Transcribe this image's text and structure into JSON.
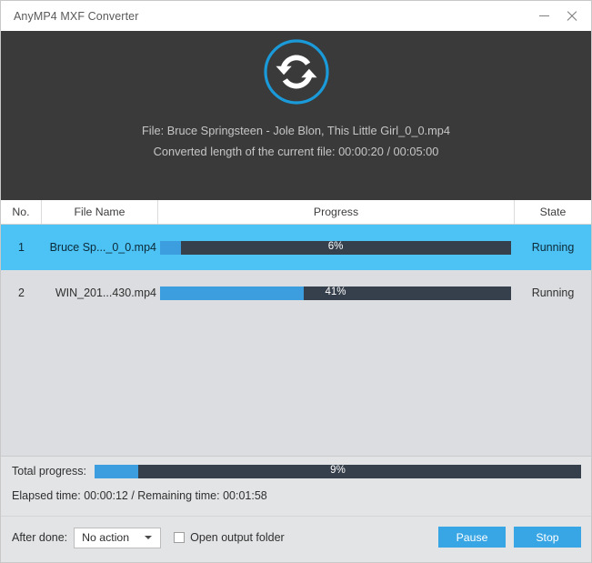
{
  "window": {
    "title": "AnyMP4 MXF Converter",
    "minimize_label": "minimize",
    "close_label": "close"
  },
  "hero": {
    "icon": "sync-circle-icon",
    "icon_ring_color": "#1a9ad9",
    "background": "#3a3a3a",
    "file_line": "File: Bruce Springsteen - Jole Blon, This Little Girl_0_0.mp4",
    "length_line": "Converted length of the current file: 00:00:20 / 00:05:00"
  },
  "table": {
    "headers": {
      "no": "No.",
      "file_name": "File Name",
      "progress": "Progress",
      "state": "State"
    },
    "rows": [
      {
        "no": "1",
        "file_name": "Bruce Sp..._0_0.mp4",
        "percent": 6,
        "progress_label": "6%",
        "state": "Running",
        "selected": true
      },
      {
        "no": "2",
        "file_name": "WIN_201...430.mp4",
        "percent": 41,
        "progress_label": "41%",
        "state": "Running",
        "selected": false
      }
    ]
  },
  "total": {
    "label": "Total progress:",
    "percent": 9,
    "progress_label": "9%",
    "time_line": "Elapsed time: 00:00:12 / Remaining time: 00:01:58"
  },
  "footer": {
    "after_done_label": "After done:",
    "after_done_value": "No action",
    "after_done_options": [
      "No action"
    ],
    "open_output_folder_label": "Open output folder",
    "open_output_folder_checked": false,
    "pause_label": "Pause",
    "stop_label": "Stop"
  },
  "colors": {
    "accent_blue": "#38a5e4",
    "selection_blue": "#4cc2f5",
    "bar_track": "#36404c",
    "bar_fill": "#3c9ede",
    "panel_dark": "#3a3a3a",
    "list_background": "#dcdde0"
  }
}
